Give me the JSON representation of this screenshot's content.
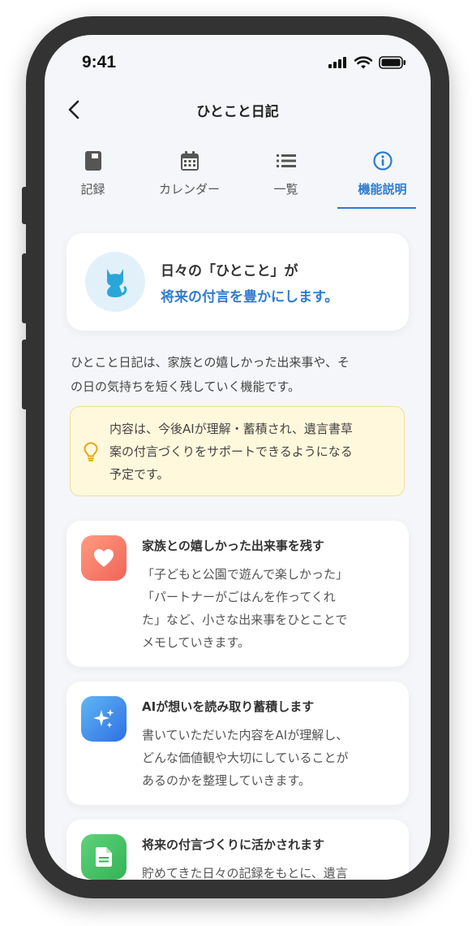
{
  "status_bar": {
    "time": "9:41"
  },
  "header": {
    "title": "ひとこと日記"
  },
  "tabs": [
    {
      "label": "記録",
      "icon": "book-icon",
      "active": false
    },
    {
      "label": "カレンダー",
      "icon": "calendar-icon",
      "active": false
    },
    {
      "label": "一覧",
      "icon": "list-icon",
      "active": false
    },
    {
      "label": "機能説明",
      "icon": "info-icon",
      "active": true
    }
  ],
  "hero": {
    "line1": "日々の「ひとこと」が",
    "line2": "将来の付言を豊かにします。",
    "icon": "cat-icon"
  },
  "intro": {
    "line1": "ひとこと日記は、家族との嬉しかった出来事や、そ",
    "line2": "の日の気持ちを短く残していく機能です。"
  },
  "notice": {
    "icon": "lightbulb-icon",
    "line1": "内容は、今後AIが理解・蓄積され、遺言書草",
    "line2": "案の付言づくりをサポートできるようになる",
    "line3": "予定です。"
  },
  "features": [
    {
      "icon": "heart-icon",
      "title": "家族との嬉しかった出来事を残す",
      "lines": [
        "「子どもと公園で遊んで楽しかった」",
        "「パートナーがごはんを作ってくれ",
        "た」など、小さな出来事をひとことで",
        "メモしていきます。"
      ]
    },
    {
      "icon": "sparkle-icon",
      "title": "AIが想いを読み取り蓄積します",
      "lines": [
        "書いていただいた内容をAIが理解し、",
        "どんな価値観や大切にしていることが",
        "あるのかを整理していきます。"
      ]
    },
    {
      "icon": "document-icon",
      "title": "将来の付言づくりに活かされます",
      "lines": [
        "貯めてきた日々の記録をもとに、遺言"
      ]
    }
  ],
  "colors": {
    "accent": "#2f7bd0",
    "notice_bg": "#fff8dc"
  }
}
